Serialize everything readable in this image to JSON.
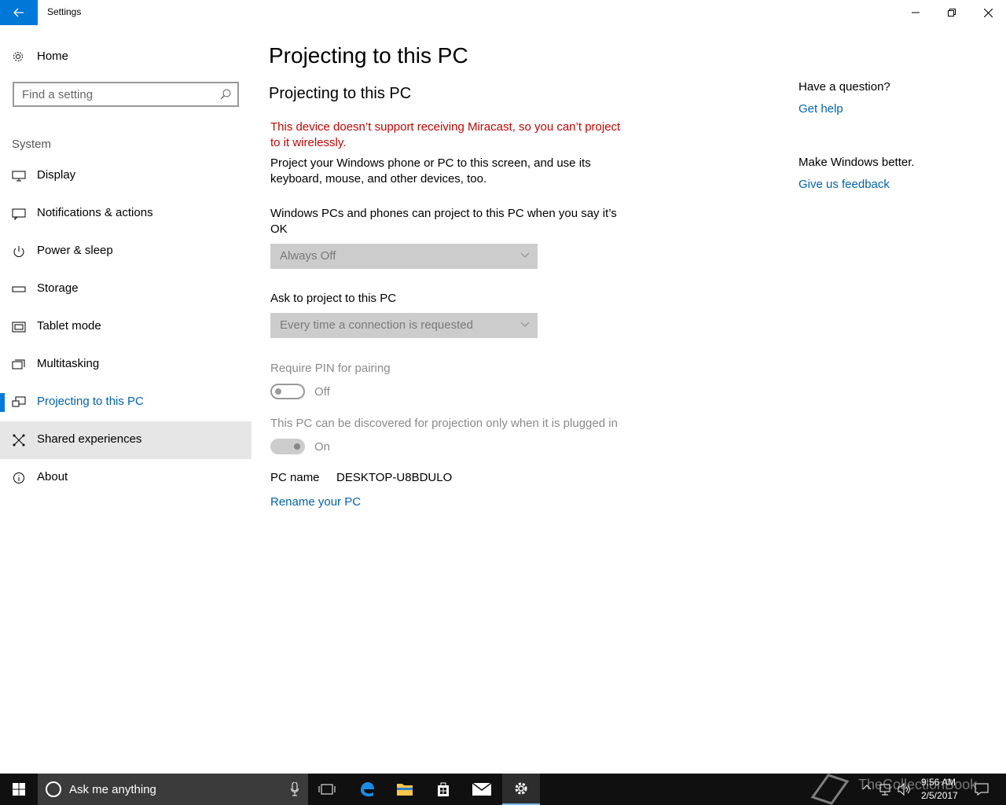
{
  "titlebar": {
    "title": "Settings"
  },
  "sidebar": {
    "home_label": "Home",
    "search_placeholder": "Find a setting",
    "section_label": "System",
    "items": [
      {
        "label": "Display",
        "icon": "monitor-icon"
      },
      {
        "label": "Notifications & actions",
        "icon": "notifications-icon"
      },
      {
        "label": "Power & sleep",
        "icon": "power-icon"
      },
      {
        "label": "Storage",
        "icon": "storage-icon"
      },
      {
        "label": "Tablet mode",
        "icon": "tablet-icon"
      },
      {
        "label": "Multitasking",
        "icon": "multitasking-icon"
      },
      {
        "label": "Projecting to this PC",
        "icon": "projecting-icon",
        "selected": true
      },
      {
        "label": "Shared experiences",
        "icon": "share-icon",
        "hover": true
      },
      {
        "label": "About",
        "icon": "info-icon"
      }
    ]
  },
  "main": {
    "page_title": "Projecting to this PC",
    "section_title": "Projecting to this PC",
    "error_text": "This device doesn’t support receiving Miracast, so you can’t project to it wirelessly.",
    "description": "Project your Windows phone or PC to this screen, and use its keyboard, mouse, and other devices, too.",
    "project_permission_label": "Windows PCs and phones can project to this PC when you say it’s OK",
    "project_permission_value": "Always Off",
    "ask_label": "Ask to project to this PC",
    "ask_value": "Every time a connection is requested",
    "pin_label": "Require PIN for pairing",
    "pin_state": "Off",
    "plugged_label": "This PC can be discovered for projection only when it is plugged in",
    "plugged_state": "On",
    "pc_name_label": "PC name",
    "pc_name_value": "DESKTOP-U8BDULO",
    "rename_link": "Rename your PC"
  },
  "right_pane": {
    "question_heading": "Have a question?",
    "help_link": "Get help",
    "feedback_heading": "Make Windows better.",
    "feedback_link": "Give us feedback"
  },
  "taskbar": {
    "search_placeholder": "Ask me anything",
    "time": "9:56 AM",
    "date": "2/5/2017",
    "watermark": "TheCollectionBook"
  },
  "colors": {
    "accent": "#0078d7",
    "link": "#0063b1",
    "error": "#c50500",
    "taskbar": "#101010"
  }
}
